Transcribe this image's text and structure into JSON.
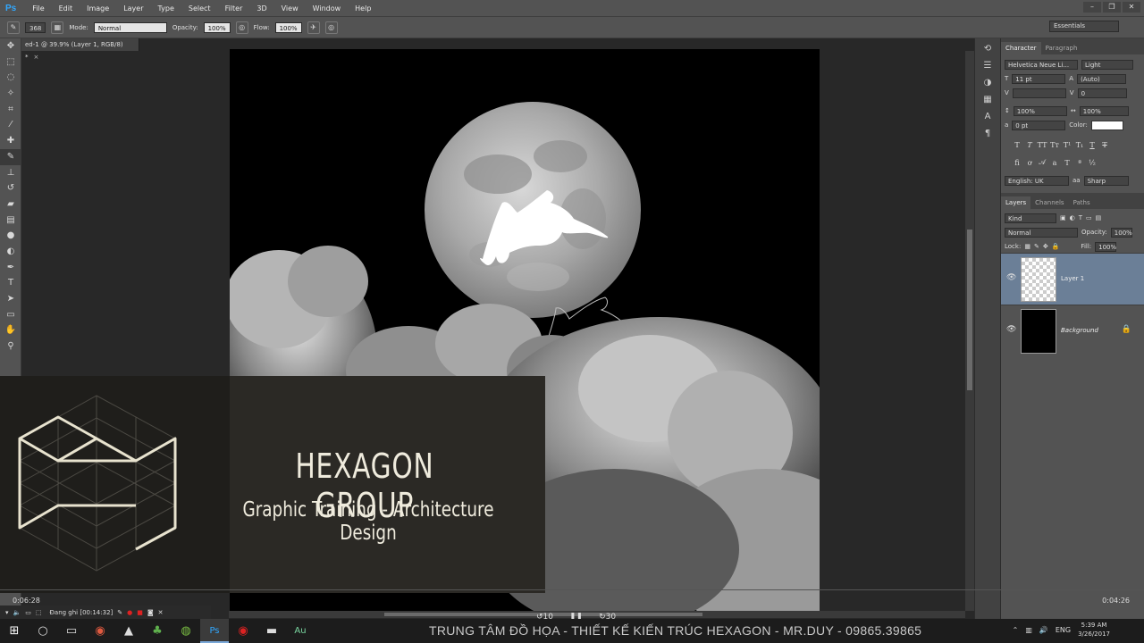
{
  "app": {
    "logo": "Ps",
    "menu": [
      "File",
      "Edit",
      "Image",
      "Layer",
      "Type",
      "Select",
      "Filter",
      "3D",
      "View",
      "Window",
      "Help"
    ]
  },
  "options": {
    "brush_size": "368",
    "mode_label": "Mode:",
    "mode_value": "Normal",
    "opacity_label": "Opacity:",
    "opacity_value": "100%",
    "flow_label": "Flow:",
    "flow_value": "100%"
  },
  "workspace": "Essentials",
  "document": {
    "tab_title": "ed-1 @ 39.9% (Layer 1, RGB/8) *"
  },
  "character_panel": {
    "tabs": [
      "Character",
      "Paragraph"
    ],
    "font_family": "Helvetica Neue Li...",
    "font_style": "Light",
    "font_size": "11 pt",
    "leading": "(Auto)",
    "tracking": "0",
    "vscale": "100%",
    "hscale": "100%",
    "baseline": "0 pt",
    "color_label": "Color:",
    "language": "English: UK",
    "antialias": "Sharp"
  },
  "layers_panel": {
    "tabs": [
      "Layers",
      "Channels",
      "Paths"
    ],
    "filter": "Kind",
    "blend_mode": "Normal",
    "opacity_label": "Opacity:",
    "opacity_value": "100%",
    "lock_label": "Lock:",
    "fill_label": "Fill:",
    "fill_value": "100%",
    "layers": [
      {
        "name": "Layer 1"
      },
      {
        "name": "Background"
      }
    ]
  },
  "overlay": {
    "title": "HEXAGON GROUP",
    "subtitle": "Graphic Training - Architecture Design"
  },
  "video": {
    "elapsed": "0:06:28",
    "remaining": "0:04:26",
    "skip_back": "10",
    "skip_fwd": "30"
  },
  "recorder": {
    "status": "Đang ghi [00:14:32]"
  },
  "taskbar": {
    "marquee": "TRUNG TÂM ĐỒ HỌA - THIẾT KẾ KIẾN TRÚC HEXAGON - MR.DUY - 09865.39865",
    "lang": "ENG",
    "time": "5:39 AM",
    "date": "3/26/2017"
  },
  "colors": {
    "ps_panel": "#535353",
    "layer_selected": "#6b7f97",
    "overlay_text": "#efebdd"
  }
}
